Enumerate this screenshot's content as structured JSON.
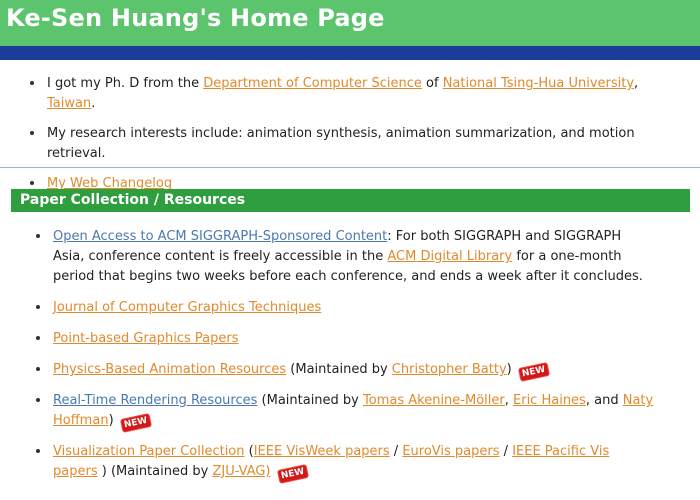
{
  "header": {
    "title": "Ke-Sen Huang's Home Page"
  },
  "intro": {
    "phd_prefix": "I got my Ph. D from the",
    "dept_link": "Department of Computer Science",
    "of": "of",
    "univ_link": "National Tsing-Hua University",
    "comma": ",",
    "country_link": "Taiwan",
    "period": ".",
    "research": "My research interests include: animation synthesis, animation summarization, and motion retrieval.",
    "changelog_link": "My Web Changelog"
  },
  "section": {
    "title": "Paper Collection / Resources"
  },
  "resources": {
    "acm_link": "Open Access to ACM SIGGRAPH-Sponsored Content",
    "acm_text1": ": For both SIGGRAPH and SIGGRAPH Asia, conference content is freely accessible in the",
    "acm_dl_link": "ACM Digital Library",
    "acm_text2": "for a one-month period that begins two weeks before each conference, and ends a week after it concludes.",
    "jcgt_link": "Journal of Computer Graphics Techniques",
    "point_link": "Point-based Graphics Papers",
    "physics_link": "Physics-Based Animation Resources",
    "physics_maint": "(Maintained by",
    "batty_link": "Christopher Batty",
    "close_paren": ")",
    "rtr_link": "Real-Time Rendering Resources",
    "rtr_maint": "(Maintained by",
    "akenine_link": "Tomas Akenine-Möller",
    "comma": ",",
    "haines_link": "Eric Haines",
    "and": ", and",
    "naty_link": "Naty Hoffman",
    "vis_link": "Visualization Paper Collection",
    "vis_open": "(",
    "visweek_link": "IEEE VisWeek papers",
    "slash": "/",
    "eurovis_link": "EuroVis papers",
    "pacificvis_link": "IEEE Pacific Vis papers",
    "vis_close": ")",
    "vis_maint": "(Maintained by",
    "zju_link": "ZJU-VAG)",
    "new_badge": "NEW"
  },
  "colors": {
    "header_green": "#5cc46d",
    "bar_blue": "#1a3d99",
    "section_green": "#2e9e3f",
    "link_orange": "#e08a2c",
    "link_blue": "#4a78b0"
  }
}
